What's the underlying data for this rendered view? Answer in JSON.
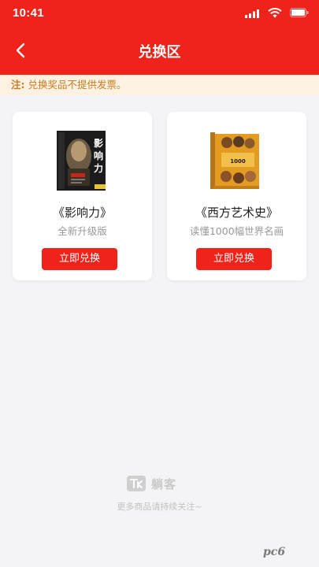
{
  "status_bar": {
    "time": "10:41"
  },
  "header": {
    "title": "兑换区",
    "back_icon": "chevron-left-icon",
    "background_color": "#f0231a"
  },
  "notice": {
    "label": "注:",
    "text": " 兑换奖品不提供发票。",
    "background_color": "#fdf1e2",
    "text_color": "#c97d23"
  },
  "products": [
    {
      "title": "《影响力》",
      "subtitle": "全新升级版",
      "button_label": "立即兑换",
      "cover_title": "影响力"
    },
    {
      "title": "《西方艺术史》",
      "subtitle": "读懂1000幅世界名画",
      "button_label": "立即兑换",
      "cover_title": "1000幅世界名画"
    }
  ],
  "footer": {
    "brand": "躺客",
    "note": "更多商品请持续关注~"
  },
  "watermark": {
    "text": "pc6"
  }
}
